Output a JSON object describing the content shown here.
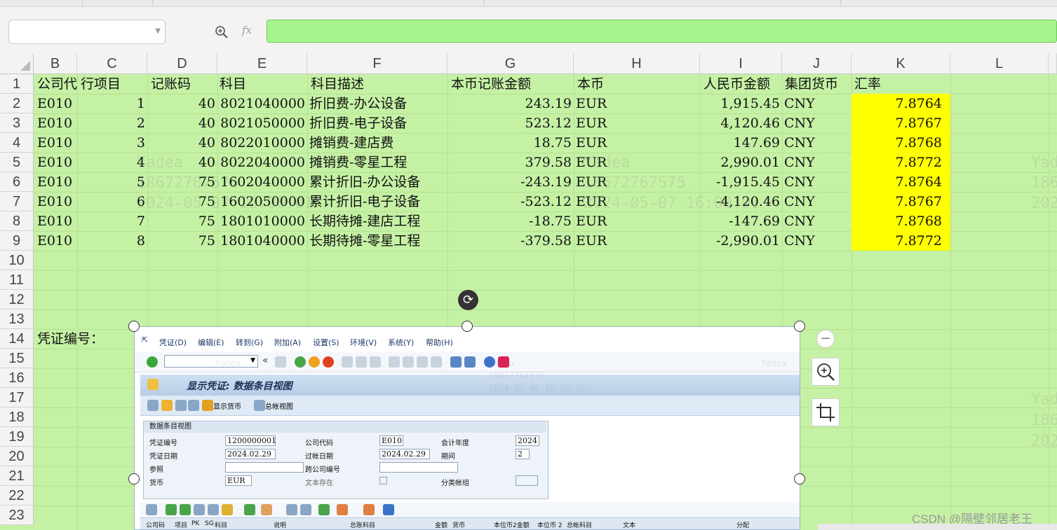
{
  "name_box": {
    "value": ""
  },
  "formula_bar": {
    "fx_label": "fx",
    "value": ""
  },
  "columns": [
    "B",
    "C",
    "D",
    "E",
    "F",
    "G",
    "H",
    "I",
    "J",
    "K",
    "L"
  ],
  "rows": [
    "1",
    "2",
    "3",
    "4",
    "5",
    "6",
    "7",
    "8",
    "9",
    "10",
    "11",
    "12",
    "13",
    "14",
    "15",
    "16",
    "17",
    "18",
    "19",
    "20",
    "21",
    "22",
    "23"
  ],
  "table": {
    "headers": {
      "B": "公司代码",
      "C": "行项目",
      "D": "记账码",
      "E": "科目",
      "F": "科目描述",
      "G": "本币记账金额",
      "H": "本币",
      "I": "人民币金额",
      "J": "集团货币",
      "K": "汇率"
    },
    "records": [
      {
        "B": "E010",
        "C": "1",
        "D": "40",
        "E": "8021040000",
        "F": "折旧费-办公设备",
        "G": "243.19",
        "H": "EUR",
        "I": "1,915.45",
        "J": "CNY",
        "K": "7.8764"
      },
      {
        "B": "E010",
        "C": "2",
        "D": "40",
        "E": "8021050000",
        "F": "折旧费-电子设备",
        "G": "523.12",
        "H": "EUR",
        "I": "4,120.46",
        "J": "CNY",
        "K": "7.8767"
      },
      {
        "B": "E010",
        "C": "3",
        "D": "40",
        "E": "8022010000",
        "F": "摊销费-建店费",
        "G": "18.75",
        "H": "EUR",
        "I": "147.69",
        "J": "CNY",
        "K": "7.8768"
      },
      {
        "B": "E010",
        "C": "4",
        "D": "40",
        "E": "8022040000",
        "F": "摊销费-零星工程",
        "G": "379.58",
        "H": "EUR",
        "I": "2,990.01",
        "J": "CNY",
        "K": "7.8772"
      },
      {
        "B": "E010",
        "C": "5",
        "D": "75",
        "E": "1602040000",
        "F": "累计折旧-办公设备",
        "G": "-243.19",
        "H": "EUR",
        "I": "-1,915.45",
        "J": "CNY",
        "K": "7.8764"
      },
      {
        "B": "E010",
        "C": "6",
        "D": "75",
        "E": "1602050000",
        "F": "累计折旧-电子设备",
        "G": "-523.12",
        "H": "EUR",
        "I": "-4,120.46",
        "J": "CNY",
        "K": "7.8767"
      },
      {
        "B": "E010",
        "C": "7",
        "D": "75",
        "E": "1801010000",
        "F": "长期待摊-建店工程",
        "G": "-18.75",
        "H": "EUR",
        "I": "-147.69",
        "J": "CNY",
        "K": "7.8768"
      },
      {
        "B": "E010",
        "C": "8",
        "D": "75",
        "E": "1801040000",
        "F": "长期待摊-零星工程",
        "G": "-379.58",
        "H": "EUR",
        "I": "-2,990.01",
        "J": "CNY",
        "K": "7.8772"
      }
    ],
    "voucher_label": "凭证编号："
  },
  "watermark": {
    "name": "Yadea",
    "phone": "18672767575",
    "time": "2024-05-07 16:00:01",
    "time2": "2024-05-06 18:56:39"
  },
  "sap": {
    "menu": [
      "凭证(D)",
      "编辑(E)",
      "转到(G)",
      "附加(A)",
      "设置(S)",
      "环境(V)",
      "系统(Y)",
      "帮助(H)"
    ],
    "title": "显示凭证: 数据条目视图",
    "app_buttons": [
      "显示货币",
      "总帐视图"
    ],
    "frame_title": "数据条目视图",
    "fields": {
      "doc_no_label": "凭证编号",
      "doc_no": "1200000001",
      "company_label": "公司代码",
      "company": "E010",
      "fiscal_year_label": "会计年度",
      "fiscal_year": "2024",
      "doc_date_label": "凭证日期",
      "doc_date": "2024.02.29",
      "post_date_label": "过帐日期",
      "post_date": "2024.02.29",
      "period_label": "期间",
      "period": "2",
      "ref_label": "参照",
      "ref": "",
      "intercompany_label": "跨公司编号",
      "intercompany": "",
      "currency_label": "货币",
      "currency": "EUR",
      "text_exists_label": "文本存在",
      "ledger_group_label": "分类帐组",
      "ledger_group": ""
    },
    "grid_headers": [
      "公司码",
      "项目",
      "PK",
      "SG",
      "科目",
      "说明",
      "总账科目",
      "金额",
      "货币",
      "本位币2金额",
      "本位币 2",
      "总帐科目",
      "文本",
      "分配"
    ]
  },
  "credit": "CSDN @隔壁邻居老王",
  "colors": {
    "sheet_bg": "#c5f1a5",
    "formula_bg": "#a8f48c",
    "highlight": "#ffff00"
  }
}
